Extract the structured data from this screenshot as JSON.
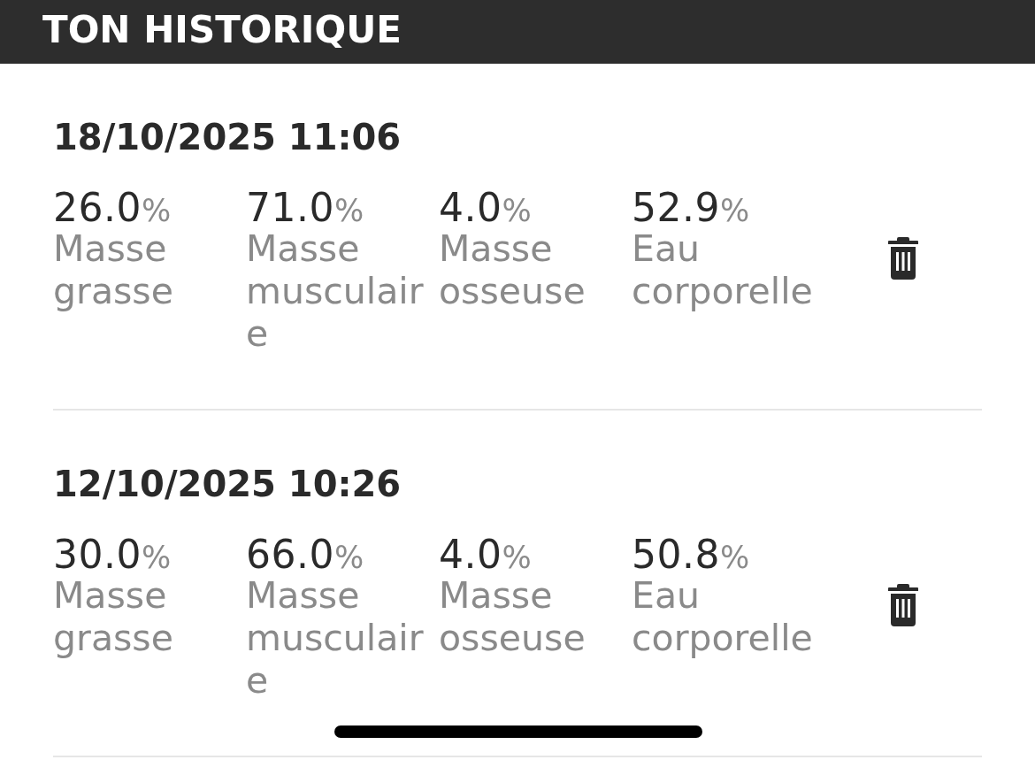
{
  "header": {
    "title": "TON HISTORIQUE"
  },
  "entries": [
    {
      "date": "18/10/2025 11:06",
      "metrics": [
        {
          "value": "26.0",
          "unit": "%",
          "label": "Masse grasse"
        },
        {
          "value": "71.0",
          "unit": "%",
          "label": "Masse musculaire"
        },
        {
          "value": "4.0",
          "unit": "%",
          "label": "Masse osseuse"
        },
        {
          "value": "52.9",
          "unit": "%",
          "label": "Eau corporelle"
        }
      ]
    },
    {
      "date": "12/10/2025 10:26",
      "metrics": [
        {
          "value": "30.0",
          "unit": "%",
          "label": "Masse grasse"
        },
        {
          "value": "66.0",
          "unit": "%",
          "label": "Masse musculaire"
        },
        {
          "value": "4.0",
          "unit": "%",
          "label": "Masse osseuse"
        },
        {
          "value": "50.8",
          "unit": "%",
          "label": "Eau corporelle"
        }
      ]
    }
  ]
}
